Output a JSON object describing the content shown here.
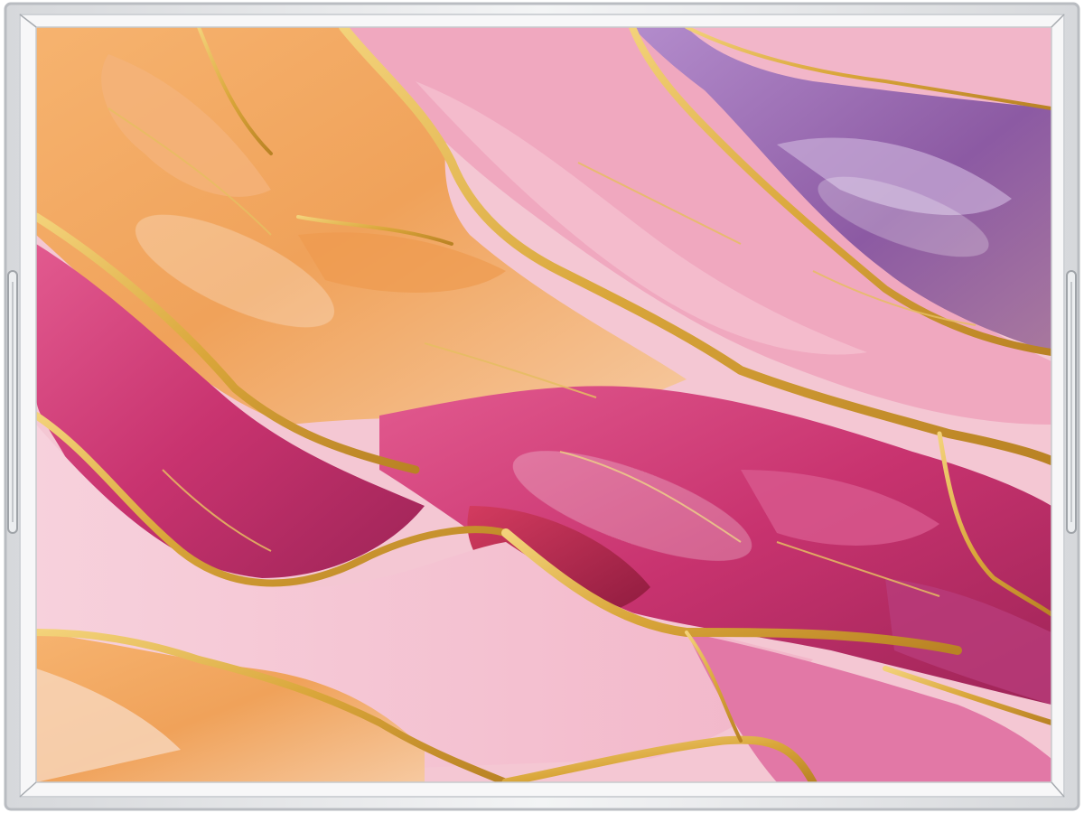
{
  "product": {
    "kind": "acrylic serving tray",
    "icon": "tray-icon"
  },
  "artwork": {
    "style": "alcohol ink marble",
    "palette": {
      "gold": "#d9a63a",
      "gold_light": "#f3d27a",
      "orange": "#f0a25a",
      "peach": "#f6c9a0",
      "magenta": "#c8336f",
      "crimson": "#b8204a",
      "pink": "#f2b6c9",
      "blush": "#f4c7d3",
      "violet": "#8c5aa3",
      "lilac": "#b38ccc",
      "frame": "#e9eaec",
      "frame_edge": "#b9bcc1"
    }
  },
  "handles": {
    "left": "left-handle-icon",
    "right": "right-handle-icon"
  }
}
